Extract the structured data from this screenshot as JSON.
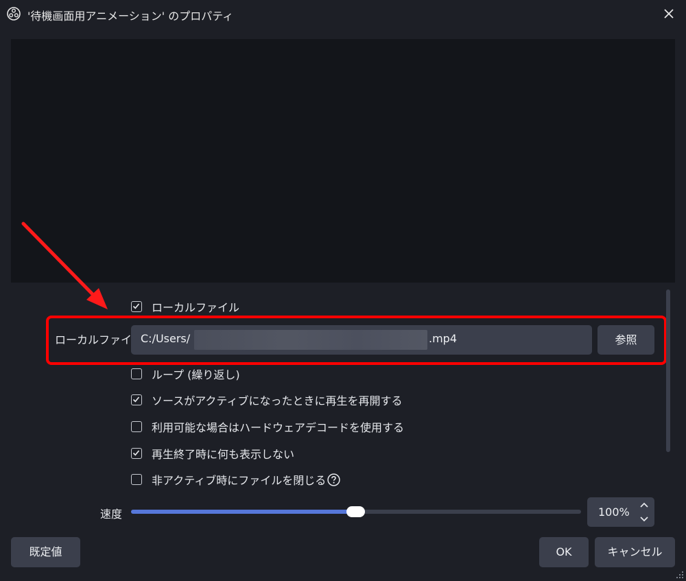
{
  "window": {
    "title": "'待機画面用アニメーション' のプロパティ"
  },
  "options": {
    "local_file_checkbox": {
      "label": "ローカルファイル",
      "checked": true
    },
    "loop": {
      "label": "ループ (繰り返し)",
      "checked": false
    },
    "restart_on_active": {
      "label": "ソースがアクティブになったときに再生を再開する",
      "checked": true
    },
    "hw_decode": {
      "label": "利用可能な場合はハードウェアデコードを使用する",
      "checked": false
    },
    "show_nothing_on_end": {
      "label": "再生終了時に何も表示しない",
      "checked": true
    },
    "close_file_inactive": {
      "label": "非アクティブ時にファイルを閉じる",
      "checked": false
    }
  },
  "local_file": {
    "label": "ローカルファイル",
    "path_prefix": "C:/Users/",
    "path_suffix": ".mp4",
    "browse_label": "参照"
  },
  "speed": {
    "label": "速度",
    "value_text": "100%",
    "fraction": 0.5
  },
  "footer": {
    "defaults_label": "既定値",
    "ok_label": "OK",
    "cancel_label": "キャンセル"
  },
  "colors": {
    "background": "#1d1f26",
    "preview": "#13151a",
    "field": "#3b3f4c",
    "accent": "#5677d9",
    "highlight": "#ff0000"
  },
  "icons": [
    "obs-logo-icon",
    "close-icon",
    "checkmark-icon",
    "help-icon",
    "chevron-up-icon",
    "chevron-down-icon",
    "resize-grip-icon",
    "annotation-arrow-icon"
  ]
}
